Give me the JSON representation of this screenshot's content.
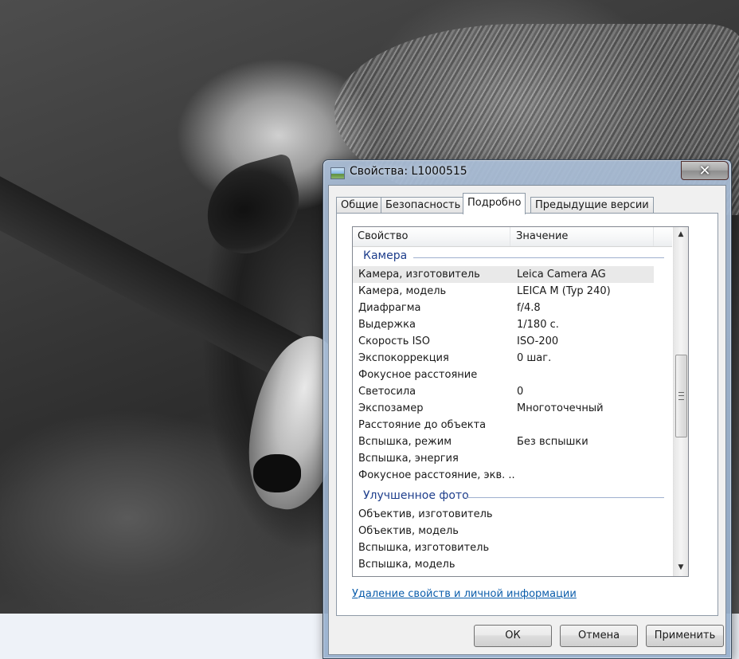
{
  "window": {
    "title": "Свойства: L1000515",
    "close_symbol": "✕"
  },
  "tabs": [
    {
      "label": "Общие",
      "active": false
    },
    {
      "label": "Безопасность",
      "active": false
    },
    {
      "label": "Подробно",
      "active": true
    },
    {
      "label": "Предыдущие версии",
      "active": false
    }
  ],
  "list": {
    "columns": {
      "property": "Свойство",
      "value": "Значение"
    },
    "groups": [
      {
        "label": "Камера",
        "rows": [
          {
            "name": "Камера, изготовитель",
            "value": "Leica Camera AG",
            "selected": true
          },
          {
            "name": "Камера, модель",
            "value": "LEICA M (Typ 240)"
          },
          {
            "name": "Диафрагма",
            "value": "f/4.8"
          },
          {
            "name": "Выдержка",
            "value": "1/180 с."
          },
          {
            "name": "Скорость ISO",
            "value": "ISO-200"
          },
          {
            "name": "Экспокоррекция",
            "value": "0 шаг."
          },
          {
            "name": "Фокусное расстояние",
            "value": ""
          },
          {
            "name": "Светосила",
            "value": "0"
          },
          {
            "name": "Экспозамер",
            "value": "Многоточечный"
          },
          {
            "name": "Расстояние до объекта",
            "value": ""
          },
          {
            "name": "Вспышка, режим",
            "value": "Без вспышки"
          },
          {
            "name": "Вспышка, энергия",
            "value": ""
          },
          {
            "name": "Фокусное расстояние, экв. ...",
            "value": ""
          }
        ]
      },
      {
        "label": "Улучшенное фото",
        "rows": [
          {
            "name": "Объектив, изготовитель",
            "value": ""
          },
          {
            "name": "Объектив, модель",
            "value": ""
          },
          {
            "name": "Вспышка, изготовитель",
            "value": ""
          },
          {
            "name": "Вспышка, модель",
            "value": ""
          }
        ]
      }
    ]
  },
  "scrollbar": {
    "up": "▲",
    "down": "▼"
  },
  "remove_link": "Удаление свойств и личной информации",
  "buttons": {
    "ok": "ОК",
    "cancel": "Отмена",
    "apply": "Применить"
  }
}
